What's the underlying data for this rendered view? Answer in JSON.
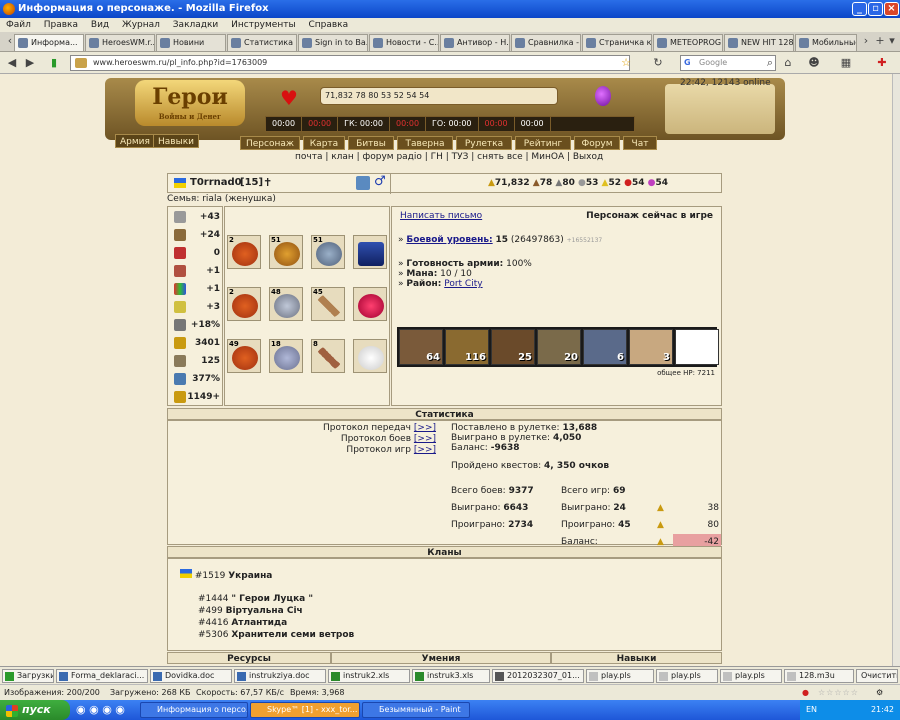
{
  "window": {
    "title": "Информация о персонаже. - Mozilla Firefox"
  },
  "menu": [
    "Файл",
    "Правка",
    "Вид",
    "Журнал",
    "Закладки",
    "Инструменты",
    "Справка"
  ],
  "tabs": [
    "Информа...",
    "HeroesWM.r...",
    "Новини",
    "Статистика ...",
    "Sign in to Ba...",
    "Новости - С...",
    "Антивор - Н...",
    "Сравнилка - ...",
    "Страничка к...",
    "METEOPROG...",
    "NEW HIT 128...",
    "Мобильные ..."
  ],
  "nav": {
    "url": "www.heroeswm.ru/pl_info.php?id=1763009",
    "search_placeholder": "Google"
  },
  "game_header": {
    "logo": "Герои",
    "logo_sub": "Войны и Денег",
    "resources": "71,832   78   80   53   52   54   54",
    "time_online": "22:42, 12143 online",
    "timers": [
      "00:00",
      "00:00",
      "ГК: 00:00",
      "00:00",
      "ГО: 00:00",
      "00:00",
      "00:00"
    ],
    "side_buttons": [
      "Армия",
      "Навыки"
    ],
    "main_nav": [
      "Персонаж",
      "Карта",
      "Битвы",
      "Таверна",
      "Рулетка",
      "Рейтинг",
      "Форум",
      "Чат"
    ],
    "links": "почта | клан | форум радіо | ГН | ТУЗ | снять все | МинОА | Выход"
  },
  "player": {
    "name": "T0rrnad0",
    "level_tag": "[15]",
    "family": "Семья: riala (женушка)",
    "resources": [
      "71,832",
      "78",
      "80",
      "53",
      "52",
      "54",
      "54"
    ],
    "stats": [
      "+43",
      "+24",
      "0",
      "+1",
      "+1",
      "+3",
      "+18%",
      "3401",
      "125",
      "377%",
      "1149+"
    ],
    "slots": [
      "2",
      "51",
      "51",
      "",
      "2",
      "48",
      "45",
      "",
      "49",
      "18",
      "8",
      ""
    ],
    "write_letter": "Написать письмо",
    "in_game": "Персонаж сейчас в игре",
    "combat_level_label": "Боевой уровень:",
    "combat_level": "15",
    "combat_exp": "(26497863)",
    "combat_exp_extra": "+16552137",
    "army_ready_label": "Готовность армии:",
    "army_ready": "100%",
    "mana_label": "Мана:",
    "mana": "10 / 10",
    "district_label": "Район:",
    "district": "Port City",
    "army_counts": [
      "64",
      "116",
      "25",
      "20",
      "6",
      "3",
      ""
    ],
    "total_hp": "общее HP: 7211"
  },
  "stats_section": {
    "title": "Статистика",
    "protocols": [
      "Протокол передач",
      "Протокол боев",
      "Протокол игр"
    ],
    "proto_link": "[>>]",
    "roulette_bet_label": "Поставлено в рулетке:",
    "roulette_bet": "13,688",
    "roulette_won_label": "Выиграно в рулетке:",
    "roulette_won": "4,050",
    "balance_label": "Баланс:",
    "balance": "-9638",
    "quests_label": "Пройдено квестов:",
    "quests": "4, 350 очков",
    "battles_label": "Всего боев:",
    "battles": "9377",
    "b_won_label": "Выиграно:",
    "b_won": "6643",
    "b_lost_label": "Проиграно:",
    "b_lost": "2734",
    "games_label": "Всего игр:",
    "games": "69",
    "g_won_label": "Выиграно:",
    "g_won": "24",
    "g_won_gold": "38",
    "g_lost_label": "Проиграно:",
    "g_lost": "45",
    "g_lost_gold": "80",
    "g_balance_label": "Баланс:",
    "g_balance": "-42"
  },
  "clans_section": {
    "title": "Кланы",
    "clans": [
      {
        "id": "#1519",
        "name": "Украина"
      },
      {
        "id": "#1444",
        "name": "\" Герои Луцка \""
      },
      {
        "id": "#499",
        "name": "Віртуальна Січ"
      },
      {
        "id": "#4416",
        "name": "Атлантида"
      },
      {
        "id": "#5306",
        "name": "Хранители семи ветров"
      }
    ]
  },
  "bottom_sections": [
    "Ресурсы",
    "Умения",
    "Навыки"
  ],
  "downloads": [
    "Загрузки",
    "Forma_deklaraci...",
    "Dovidka.doc",
    "instrukziya.doc",
    "instruk2.xls",
    "instruk3.xls",
    "2012032307_01...",
    "play.pls",
    "play.pls",
    "play.pls",
    "128.m3u",
    "Очистить"
  ],
  "statusbar": {
    "images": "Изображения: 200/200",
    "loaded": "Загружено: 268 КБ",
    "speed": "Скорость: 67,57 КБ/с",
    "time": "Время: 3,968"
  },
  "taskbar": {
    "start": "пуск",
    "tasks": [
      "Информация о персо...",
      "Skype™ [1] - xxx_tor...",
      "Безымянный - Paint"
    ],
    "lang": "EN",
    "clock": "21:42"
  },
  "colors": {
    "title": "#0b46c8",
    "header_gold": "#a88a4a",
    "page_bg": "#f3ecd7",
    "balance_bg": "#e8a0a0"
  }
}
